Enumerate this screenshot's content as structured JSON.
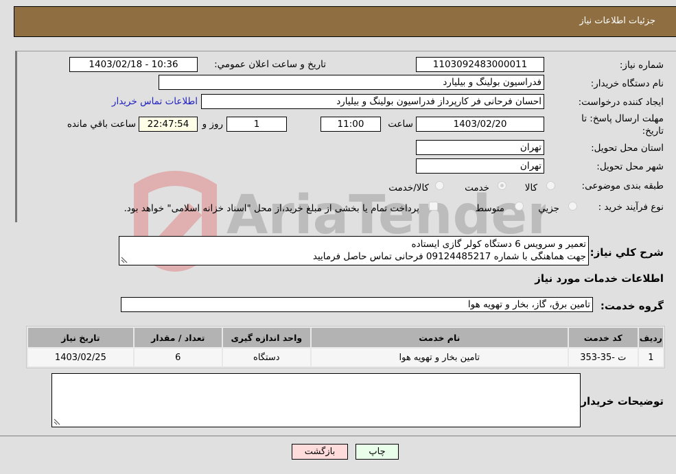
{
  "header": {
    "title": "جزئیات اطلاعات نیاز"
  },
  "form": {
    "need_number": {
      "label": "شماره نیاز:",
      "value": "1103092483000011"
    },
    "announce_datetime": {
      "label": "تاریخ و ساعت اعلان عمومي:",
      "value": "1403/02/18 - 10:36"
    },
    "buyer_org": {
      "label": "نام دستگاه خریدار:",
      "value": "فدراسیون بولینگ و بیلیارد",
      "extra_value": ""
    },
    "requester": {
      "label": "ایجاد کننده درخواست:",
      "value": "احسان  فرحانی فر کارپرداز فدراسیون بولینگ و بیلیارد",
      "contact_link": "اطلاعات تماس خریدار"
    },
    "deadline": {
      "label_line1": "مهلت ارسال پاسخ: تا",
      "label_line2": "تاریخ:",
      "date": "1403/02/20",
      "time_label": "ساعت",
      "time": "11:00",
      "days": "1",
      "days_label": "روز و",
      "remaining": "22:47:54",
      "remaining_label": "ساعت باقي مانده"
    },
    "province": {
      "label": "استان محل تحویل:",
      "value": "تهران"
    },
    "city": {
      "label": "شهر محل تحویل:",
      "value": "تهران"
    },
    "category": {
      "label": "طبقه بندی موضوعی:",
      "options": [
        "کالا",
        "خدمت",
        "کالا/خدمت"
      ],
      "selected": "خدمت"
    },
    "purchase_type": {
      "label": "نوع فرآیند خرید :",
      "options": [
        "جزيي",
        "متوسط"
      ],
      "treasury_note": "پرداخت تمام یا بخشی از مبلغ خرید،از محل \"اسناد خزانه اسلامی\" خواهد بود."
    }
  },
  "description": {
    "label": "شرح كلي نياز:",
    "lines": [
      "تعمیر و سرویس 6 دستگاه کولر گازی ایستاده",
      "جهت هماهنگی با شماره 09124485217 فرحانی تماس حاصل فرمایید"
    ]
  },
  "services_section": {
    "title": "اطلاعات خدمات مورد نیاز"
  },
  "service_group": {
    "label": "گروه خدمت:",
    "value": "تامین برق، گاز، بخار و تهویه هوا"
  },
  "table": {
    "headers": [
      "ردیف",
      "کد خدمت",
      "نام خدمت",
      "واحد اندازه گیری",
      "تعداد / مقدار",
      "تاریخ نیاز"
    ],
    "rows": [
      [
        "1",
        "ت -35-353",
        "تامین بخار و تهویه هوا",
        "دستگاه",
        "6",
        "1403/02/25"
      ]
    ]
  },
  "buyer_notes": {
    "label": "توضیحات خریدار:",
    "value": ""
  },
  "buttons": {
    "print": "چاپ",
    "back": "بازگشت"
  },
  "watermark": {
    "text": "AriaTender.neT"
  }
}
